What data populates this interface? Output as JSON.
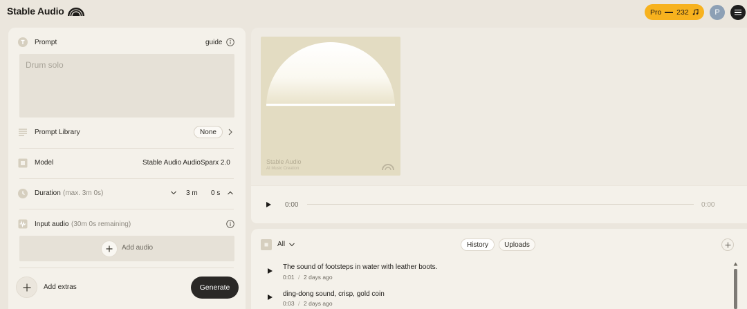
{
  "header": {
    "logo_text": "Stable Audio",
    "plan_label": "Pro",
    "credits": "232",
    "avatar_initial": "P"
  },
  "prompt": {
    "label": "Prompt",
    "guide_label": "guide",
    "placeholder": "Drum solo"
  },
  "prompt_library": {
    "label": "Prompt Library",
    "value": "None"
  },
  "model": {
    "label": "Model",
    "value": "Stable Audio AudioSparx 2.0"
  },
  "duration": {
    "label": "Duration",
    "hint": "(max. 3m 0s)",
    "minutes": "3 m",
    "seconds": "0 s"
  },
  "input_audio": {
    "label": "Input audio",
    "hint": "(30m 0s remaining)",
    "add_label": "Add audio"
  },
  "extras": {
    "label": "Add extras",
    "generate_label": "Generate"
  },
  "cover": {
    "title": "Stable Audio",
    "subtitle": "AI Music Creation"
  },
  "player": {
    "current_time": "0:00",
    "total_time": "0:00",
    "progress": 0
  },
  "library": {
    "filter": "All",
    "tabs": [
      "History",
      "Uploads"
    ],
    "active_tab": "History",
    "tracks": [
      {
        "title": "The sound of footsteps in water with leather boots.",
        "duration": "0:01",
        "age": "2 days ago"
      },
      {
        "title": "ding-dong sound, crisp, gold coin",
        "duration": "0:03",
        "age": "2 days ago"
      }
    ]
  },
  "colors": {
    "accent": "#f7b21e",
    "panel": "#f4f1ea",
    "background": "#ebe6dd",
    "cover": "#e3dcc2"
  },
  "icons": {
    "logo": "dome-logo-icon",
    "credits": "music-note-icon",
    "menu": "hamburger-icon",
    "prompt": "text-t-icon",
    "guide": "info-icon",
    "library": "list-icon",
    "model": "model-square-icon",
    "duration": "clock-icon",
    "input_audio": "waveform-icon",
    "add": "plus-icon",
    "play": "play-icon"
  }
}
